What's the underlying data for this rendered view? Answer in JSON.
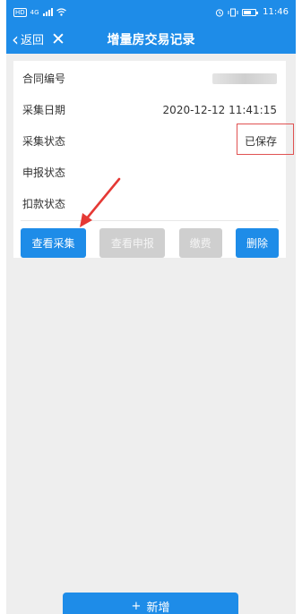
{
  "status_bar": {
    "hd_label": "HD",
    "network": "4G",
    "time": "11:46"
  },
  "navbar": {
    "back_label": "返回",
    "title": "增量房交易记录"
  },
  "record": {
    "rows": [
      {
        "label": "合同编号",
        "value": ""
      },
      {
        "label": "采集日期",
        "value": "2020-12-12 11:41:15"
      },
      {
        "label": "采集状态",
        "value": "已保存"
      },
      {
        "label": "申报状态",
        "value": ""
      },
      {
        "label": "扣款状态",
        "value": ""
      }
    ]
  },
  "actions": {
    "view_collect": "查看采集",
    "view_declare": "查看申报",
    "pay": "缴费",
    "delete": "删除"
  },
  "footer": {
    "add_icon": "+",
    "add_label": "新增"
  },
  "colors": {
    "primary": "#1e8ce8",
    "disabled": "#cfcfcf",
    "annotation_red": "#e05252"
  },
  "icons": [
    "hd-icon",
    "signal-icon",
    "wifi-icon",
    "alarm-icon",
    "vibrate-icon",
    "battery-icon",
    "back-chevron-icon",
    "close-icon",
    "plus-icon",
    "arrow-annotation"
  ]
}
